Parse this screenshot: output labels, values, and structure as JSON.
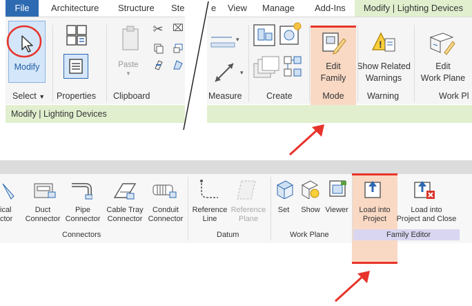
{
  "top_left": {
    "tabs": [
      "File",
      "Architecture",
      "Structure",
      "Ste"
    ],
    "modify_label": "Modify",
    "properties_label": "Properties",
    "paste_label": "Paste",
    "select_label": "Select",
    "clipboard_label": "Clipboard",
    "context_bar": "Modify | Lighting Devices"
  },
  "top_right": {
    "tabs": [
      "e",
      "View",
      "Manage",
      "Add-Ins",
      "Modify | Lighting Devices"
    ],
    "edit_family": [
      "Edit",
      "Family"
    ],
    "show_related": [
      "Show Related",
      "Warnings"
    ],
    "edit_work_plane": [
      "Edit",
      "Work Plane"
    ],
    "groups": [
      "Measure",
      "Create",
      "Mode",
      "Warning",
      "Work Pl"
    ]
  },
  "bottom": {
    "buttons": [
      [
        "ical",
        "ctor"
      ],
      [
        "Duct",
        "Connector"
      ],
      [
        "Pipe",
        "Connector"
      ],
      [
        "Cable Tray",
        "Connector"
      ],
      [
        "Conduit",
        "Connector"
      ],
      [
        "Reference",
        "Line"
      ],
      [
        "Reference",
        "Plane"
      ],
      [
        "Set",
        ""
      ],
      [
        "Show",
        ""
      ],
      [
        "Viewer",
        ""
      ],
      [
        "Load into",
        "Project"
      ],
      [
        "Load into",
        "Project and Close"
      ]
    ],
    "groups": [
      "Connectors",
      "Datum",
      "Work Plane",
      "Family Editor"
    ]
  },
  "colors": {
    "accent_blue": "#2e6ab1",
    "context_green": "#e1efcf",
    "highlight_red": "#e8332a",
    "highlight_fill": "#f9d9c4"
  }
}
